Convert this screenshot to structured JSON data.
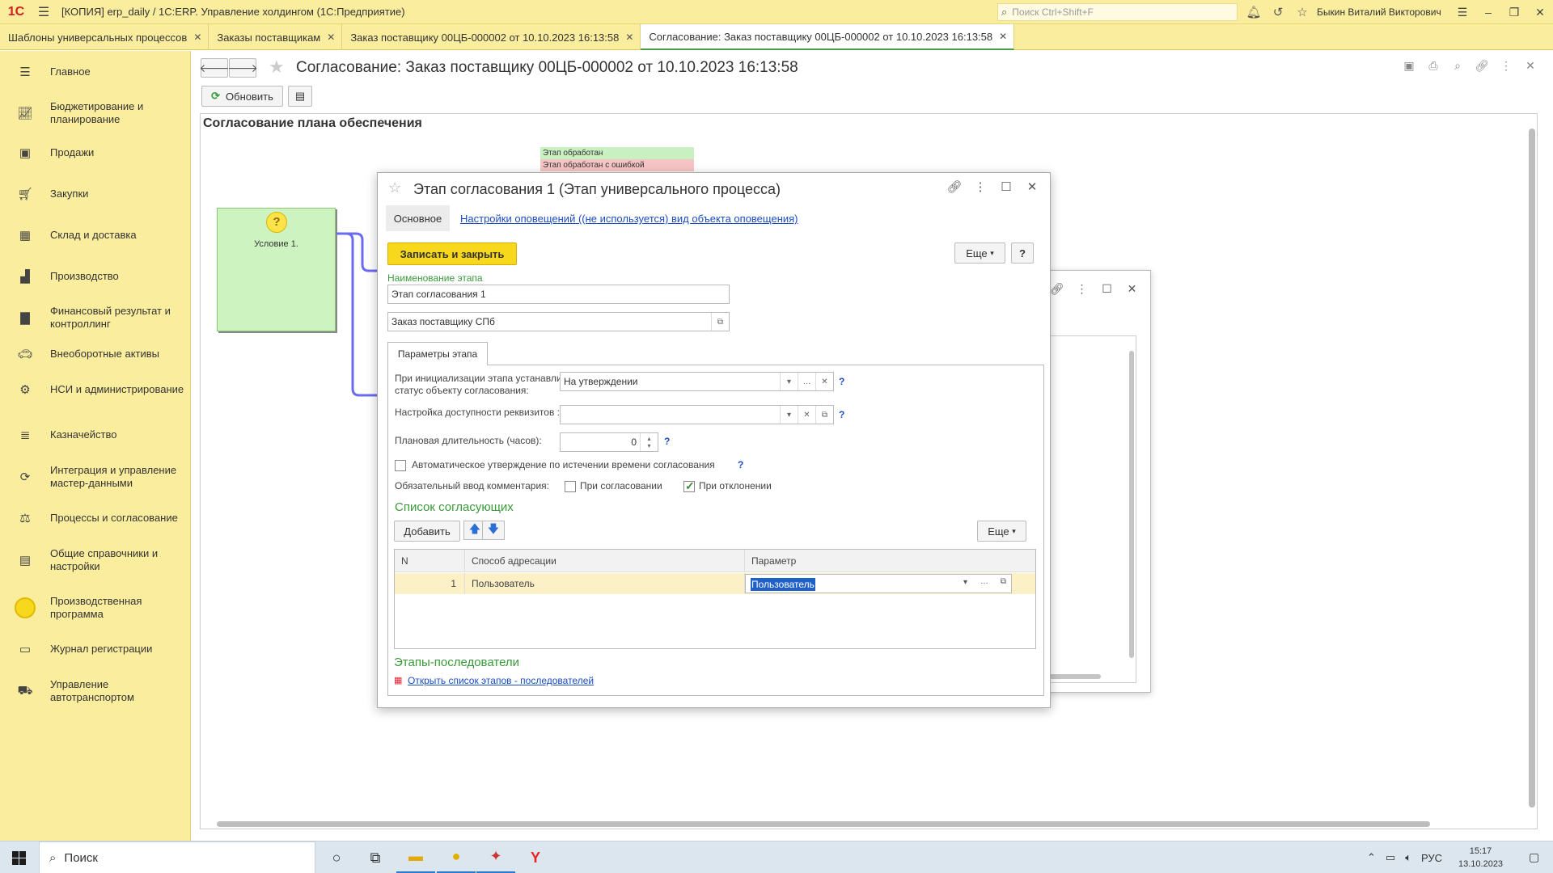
{
  "window": {
    "title": "[КОПИЯ] erp_daily / 1С:ERP. Управление холдингом  (1С:Предприятие)",
    "search_placeholder": "Поиск Ctrl+Shift+F",
    "user": "Быкин Виталий Викторович"
  },
  "tabs": [
    {
      "label": "Шаблоны универсальных процессов"
    },
    {
      "label": "Заказы поставщикам"
    },
    {
      "label": "Заказ поставщику 00ЦБ-000002 от 10.10.2023 16:13:58"
    },
    {
      "label": "Согласование: Заказ поставщику 00ЦБ-000002 от 10.10.2023 16:13:58"
    }
  ],
  "sidebar": {
    "items": [
      {
        "label": "Главное",
        "icon": "menu-icon"
      },
      {
        "label": "Бюджетирование и планирование",
        "icon": "chart-icon"
      },
      {
        "label": "Продажи",
        "icon": "bag-icon"
      },
      {
        "label": "Закупки",
        "icon": "cart-icon"
      },
      {
        "label": "Склад и доставка",
        "icon": "warehouse-icon"
      },
      {
        "label": "Производство",
        "icon": "factory-icon"
      },
      {
        "label": "Финансовый результат и контроллинг",
        "icon": "bar-chart-icon"
      },
      {
        "label": "Внеоборотные активы",
        "icon": "car-icon"
      },
      {
        "label": "НСИ и администрирование",
        "icon": "gear-icon"
      },
      {
        "label": "Казначейство",
        "icon": "coins-icon"
      },
      {
        "label": "Интеграция и управление мастер-данными",
        "icon": "sync-icon"
      },
      {
        "label": "Процессы и согласование",
        "icon": "process-icon"
      },
      {
        "label": "Общие справочники и настройки",
        "icon": "book-icon"
      },
      {
        "label": "Производственная программа",
        "icon": "circle-icon"
      },
      {
        "label": "Журнал регистрации",
        "icon": "journal-icon"
      },
      {
        "label": "Управление автотранспортом",
        "icon": "truck-icon"
      }
    ]
  },
  "main": {
    "title": "Согласование: Заказ поставщику 00ЦБ-000002 от 10.10.2023 16:13:58",
    "refresh_label": "Обновить",
    "canvas_title": "Согласование плана обеспечения",
    "legend": [
      "Этап обработан",
      "Этап обработан с ошибкой"
    ],
    "condition_label": "Условие 1."
  },
  "dialog": {
    "title": "Этап согласования 1 (Этап универсального процесса)",
    "tab_main": "Основное",
    "tab_notifications": "Настройки оповещений ((не используется) вид объекта оповещения)",
    "save_close": "Записать и закрыть",
    "more": "Еще",
    "help": "?",
    "name_label": "Наименование этапа",
    "name_value": "Этап согласования 1",
    "object_value": "Заказ поставщику СПб",
    "params_tab": "Параметры этапа",
    "init_status_label": "При инициализации этапа устанавливать статус объекту согласования:",
    "init_status_value": "На утверждении",
    "access_label": "Настройка доступности реквизитов :",
    "access_value": "",
    "duration_label": "Плановая длительность (часов):",
    "duration_value": "0",
    "auto_approve_label": "Автоматическое утверждение по истечении времени согласования",
    "auto_approve_checked": false,
    "mandatory_comment_label": "Обязательный ввод комментария:",
    "on_approve_label": "При согласовании",
    "on_approve_checked": false,
    "on_reject_label": "При отклонении",
    "on_reject_checked": true,
    "approvers_title": "Список согласующих",
    "add_label": "Добавить",
    "columns": [
      "N",
      "Способ адресации",
      "Параметр"
    ],
    "rows": [
      {
        "n": "1",
        "method": "Пользователь",
        "param": "Пользователь"
      }
    ],
    "successors_title": "Этапы-последователи",
    "successors_link": "Открыть список этапов - последователей"
  },
  "taskbar": {
    "search": "Поиск",
    "lang": "РУС",
    "time": "15:17",
    "date": "13.10.2023"
  }
}
